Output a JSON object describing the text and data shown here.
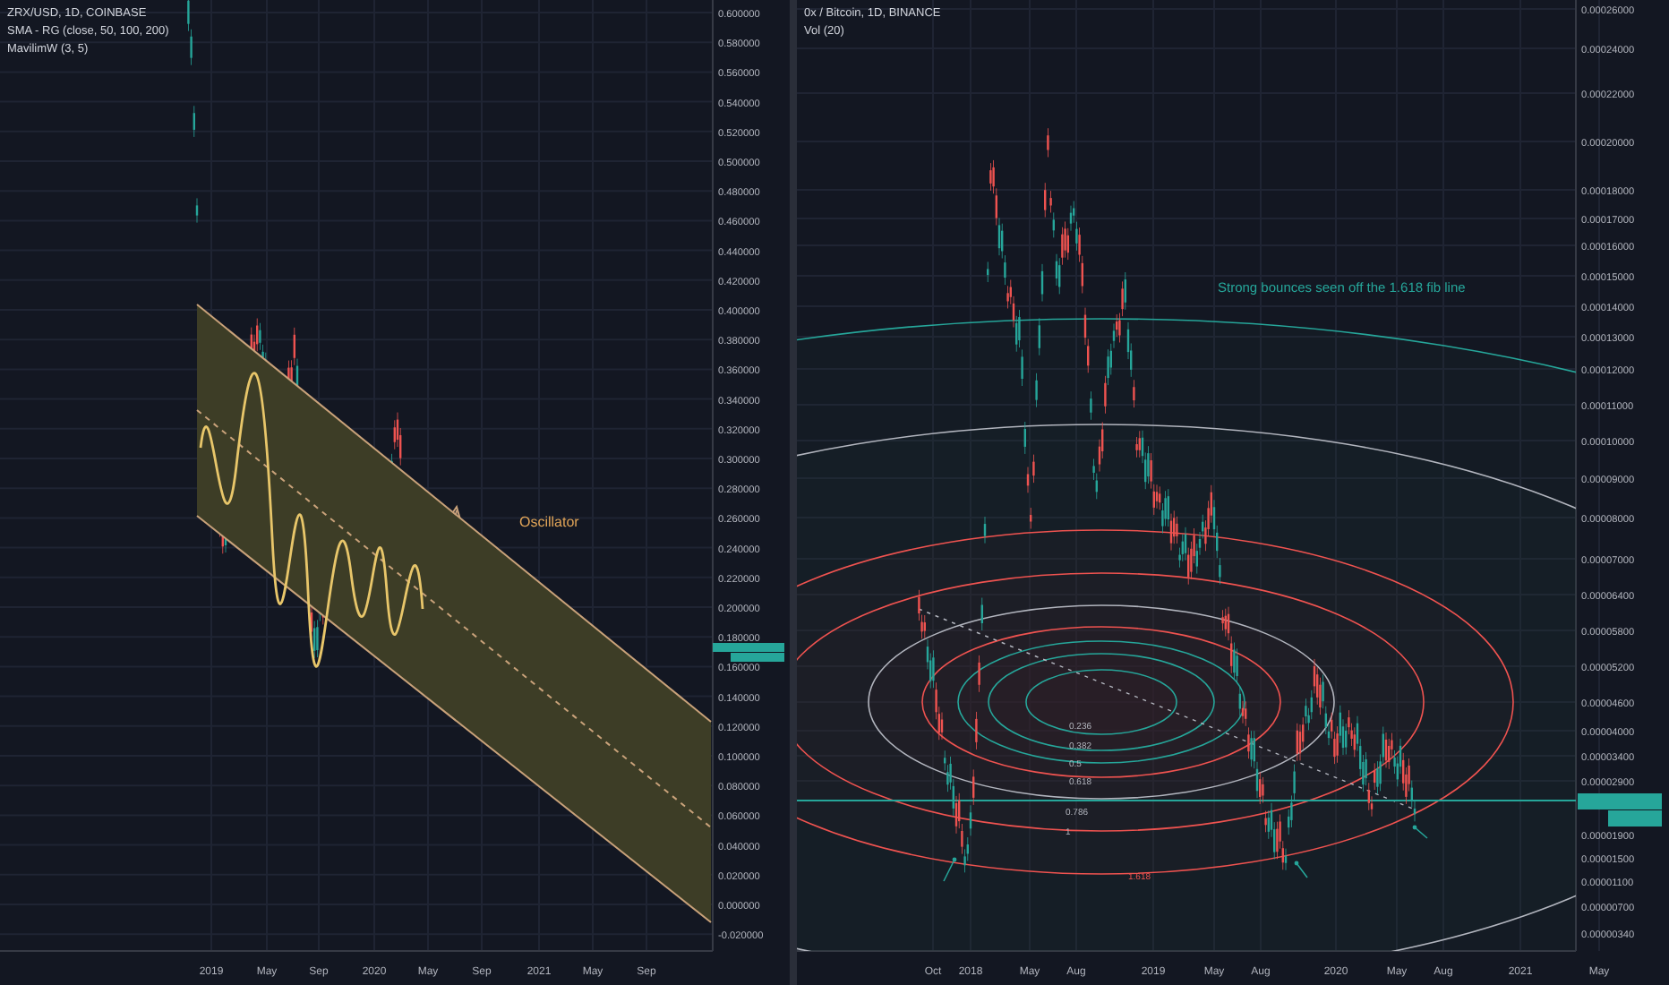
{
  "left_chart": {
    "legend": [
      "ZRX/USD, 1D, COINBASE",
      "SMA - RG (close, 50, 100, 200)",
      "MavilimW (3, 5)"
    ],
    "price_axis": [
      "0.600000",
      "0.580000",
      "0.560000",
      "0.540000",
      "0.520000",
      "0.500000",
      "0.480000",
      "0.460000",
      "0.440000",
      "0.420000",
      "0.400000",
      "0.380000",
      "0.360000",
      "0.340000",
      "0.320000",
      "0.300000",
      "0.280000",
      "0.260000",
      "0.240000",
      "0.220000",
      "0.200000",
      "0.180000",
      "0.160000",
      "0.140000",
      "0.120000",
      "0.100000",
      "0.080000",
      "0.060000",
      "0.040000",
      "0.020000",
      "0.000000",
      "-0.020000"
    ],
    "time_axis": [
      "2019",
      "May",
      "Sep",
      "2020",
      "May",
      "Sep",
      "2021",
      "May",
      "Sep"
    ],
    "annotation": "Oscillator"
  },
  "right_chart": {
    "legend": [
      "0x / Bitcoin, 1D, BINANCE",
      "Vol (20)"
    ],
    "price_axis": [
      "0.00026000",
      "0.00024000",
      "0.00022000",
      "0.00020000",
      "0.00018000",
      "0.00017000",
      "0.00016000",
      "0.00015000",
      "0.00014000",
      "0.00013000",
      "0.00012000",
      "0.00011000",
      "0.00010000",
      "0.00009000",
      "0.00008000",
      "0.00007000",
      "0.00006400",
      "0.00005800",
      "0.00005200",
      "0.00004600",
      "0.00004000",
      "0.00003400",
      "0.00002900",
      "0.00001900",
      "0.00001500",
      "0.00001100",
      "0.00000700",
      "0.00000340"
    ],
    "time_axis": [
      "Oct",
      "2018",
      "May",
      "Aug",
      "2019",
      "May",
      "Aug",
      "2020",
      "May",
      "Aug",
      "2021",
      "May"
    ],
    "annotation": "Strong bounces seen off the 1.618 fib line",
    "fib_labels": [
      "0.236",
      "0.382",
      "0.5",
      "0.618",
      "0.786",
      "1",
      "1.618"
    ]
  }
}
